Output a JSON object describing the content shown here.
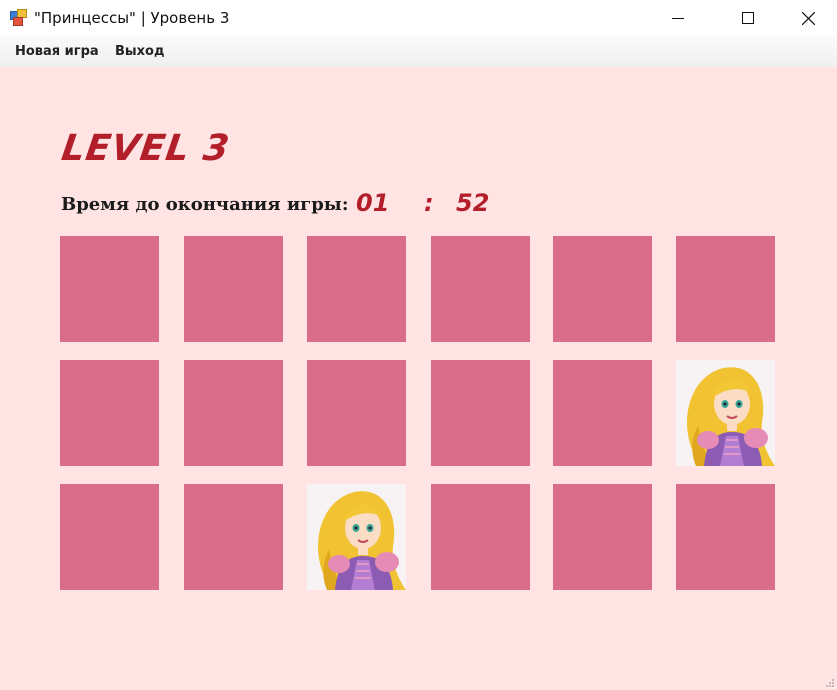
{
  "window": {
    "title": "\"Принцессы\" | Уровень 3",
    "app_icon": "windows-form-icon",
    "controls": [
      "minimize-icon",
      "maximize-icon",
      "close-icon"
    ]
  },
  "menu": {
    "items": [
      {
        "label": "Новая игра"
      },
      {
        "label": "Выход"
      }
    ]
  },
  "game": {
    "level_title": "LEVEL 3",
    "timer": {
      "label": "Время до окончания игры:",
      "minutes": "01",
      "separator": ":",
      "seconds": "52"
    },
    "grid": {
      "rows": 3,
      "columns": 6,
      "cards": [
        {
          "row": 1,
          "col": 1,
          "state": "hidden"
        },
        {
          "row": 1,
          "col": 2,
          "state": "hidden"
        },
        {
          "row": 1,
          "col": 3,
          "state": "hidden"
        },
        {
          "row": 1,
          "col": 4,
          "state": "hidden"
        },
        {
          "row": 1,
          "col": 5,
          "state": "hidden"
        },
        {
          "row": 1,
          "col": 6,
          "state": "hidden"
        },
        {
          "row": 2,
          "col": 1,
          "state": "hidden"
        },
        {
          "row": 2,
          "col": 2,
          "state": "hidden"
        },
        {
          "row": 2,
          "col": 3,
          "state": "hidden"
        },
        {
          "row": 2,
          "col": 4,
          "state": "hidden"
        },
        {
          "row": 2,
          "col": 5,
          "state": "hidden"
        },
        {
          "row": 2,
          "col": 6,
          "state": "revealed",
          "image": "rapunzel-princess"
        },
        {
          "row": 3,
          "col": 1,
          "state": "hidden"
        },
        {
          "row": 3,
          "col": 2,
          "state": "hidden"
        },
        {
          "row": 3,
          "col": 3,
          "state": "revealed",
          "image": "rapunzel-princess"
        },
        {
          "row": 3,
          "col": 4,
          "state": "hidden"
        },
        {
          "row": 3,
          "col": 5,
          "state": "hidden"
        },
        {
          "row": 3,
          "col": 6,
          "state": "hidden"
        }
      ]
    }
  },
  "colors": {
    "background": "#ffe4e3",
    "card_back": "#da6d8c",
    "accent": "#b21f2b"
  }
}
